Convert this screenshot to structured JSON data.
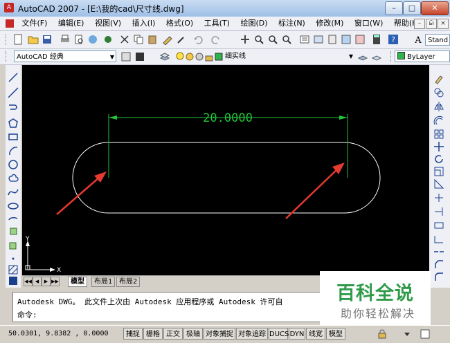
{
  "window": {
    "title": "AutoCAD 2007 - [E:\\我的cad\\尺寸线.dwg]",
    "app_icon": "A",
    "minimize": "–",
    "maximize": "□",
    "close": "✕"
  },
  "menu": {
    "items": [
      "文件(F)",
      "编辑(E)",
      "视图(V)",
      "插入(I)",
      "格式(O)",
      "工具(T)",
      "绘图(D)",
      "标注(N)",
      "修改(M)",
      "窗口(W)",
      "帮助(H)"
    ],
    "doc_min": "–",
    "doc_restore": "ӹ",
    "doc_close": "×"
  },
  "toolbar": {
    "text_style_combo": "Stand",
    "workspace_combo": "AutoCAD 经典",
    "layer_combo": "细实线",
    "color_combo": "ByLayer"
  },
  "drawing": {
    "dimension_text": "20.0000",
    "ucs_y": "Y",
    "ucs_x": "X"
  },
  "layout_tabs": {
    "nav": [
      "◀◀",
      "◀",
      "▶",
      "▶▶"
    ],
    "tabs": [
      "模型",
      "布局1",
      "布局2"
    ]
  },
  "command": {
    "history": "Autodesk DWG。  此文件上次由 Autodesk 应用程序或 Autodesk 许可自",
    "prompt": "命令:"
  },
  "status": {
    "coords": "50.0301, 9.8382 , 0.0000",
    "buttons": [
      "捕捉",
      "栅格",
      "正交",
      "极轴",
      "对象捕捉",
      "对象追踪",
      "DUCS",
      "DYN",
      "线宽",
      "模型"
    ]
  },
  "watermark": {
    "logo": "百科全说",
    "sub": "助你轻松解决"
  },
  "colors": {
    "dimension": "#22c43a",
    "geometry": "#ffffff",
    "arrow": "#e53a2f",
    "canvas": "#000000"
  }
}
